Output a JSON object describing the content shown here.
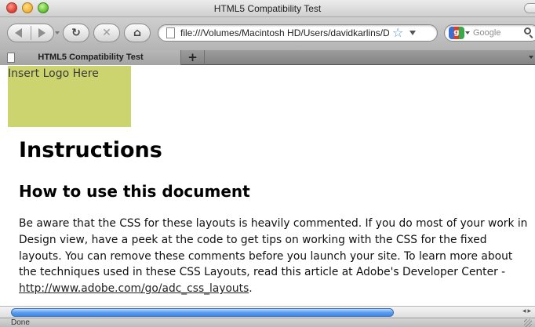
{
  "window": {
    "title": "HTML5 Compatibility Test"
  },
  "toolbar": {
    "address_url": "file:///Volumes/Macintosh HD/Users/davidkarlins/Des",
    "search_placeholder": "Google",
    "search_engine_icon": "google-icon"
  },
  "tabs": [
    {
      "label": "HTML5 Compatibility Test",
      "active": true
    }
  ],
  "tab_new_label": "+",
  "page": {
    "logo_text": "Insert Logo Here",
    "logo_color": "#cbd46e",
    "heading": "Instructions",
    "subheading": "How to use this document",
    "paragraph": "Be aware that the CSS for these layouts is heavily commented. If you do most of your work in Design view, have a peek at the code to get tips on working with the CSS for the fixed layouts. You can remove these comments before you launch your site. To learn more about the techniques used in these CSS Layouts, read this article at Adobe's Developer Center - ",
    "link_text": "http://www.adobe.com/go/adc_css_layouts",
    "paragraph_end": "."
  },
  "status": {
    "text": "Done"
  },
  "colors": {
    "scroll_thumb": "#5b9ef0"
  }
}
